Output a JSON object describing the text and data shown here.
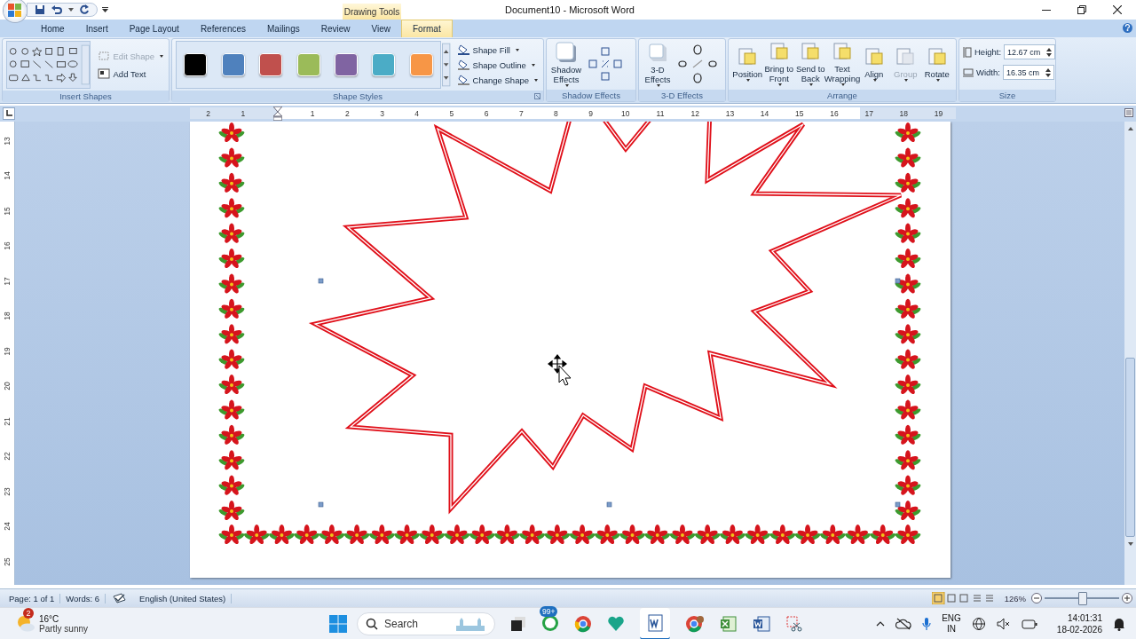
{
  "title_bar": {
    "context_label": "Drawing Tools",
    "title": "Document10 - Microsoft Word"
  },
  "tabs": [
    {
      "label": "Home",
      "selected": false
    },
    {
      "label": "Insert",
      "selected": false
    },
    {
      "label": "Page Layout",
      "selected": false
    },
    {
      "label": "References",
      "selected": false
    },
    {
      "label": "Mailings",
      "selected": false
    },
    {
      "label": "Review",
      "selected": false
    },
    {
      "label": "View",
      "selected": false
    },
    {
      "label": "Format",
      "selected": true
    }
  ],
  "ribbon": {
    "insert_shapes": {
      "edit_shape": {
        "label": "Edit Shape",
        "disabled": true
      },
      "add_text": {
        "label": "Add Text",
        "disabled": false
      },
      "group_label": "Insert Shapes"
    },
    "shape_styles": {
      "swatches": [
        {
          "color": "#000000"
        },
        {
          "color": "#4f81bd"
        },
        {
          "color": "#c0504d"
        },
        {
          "color": "#9bbb59"
        },
        {
          "color": "#8064a2"
        },
        {
          "color": "#4bacc6"
        },
        {
          "color": "#f79646"
        }
      ],
      "commands": [
        "Shape Fill",
        "Shape Outline",
        "Change Shape"
      ],
      "group_label": "Shape Styles"
    },
    "shadow_effects": {
      "button": "Shadow Effects",
      "group_label": "Shadow Effects"
    },
    "effects_3d": {
      "button": "3-D Effects",
      "group_label": "3-D Effects"
    },
    "arrange": {
      "buttons": [
        {
          "label": "Position",
          "disabled": false
        },
        {
          "label": "Bring to Front",
          "disabled": false
        },
        {
          "label": "Send to Back",
          "disabled": false
        },
        {
          "label": "Text Wrapping",
          "disabled": false
        },
        {
          "label": "Align",
          "disabled": false
        },
        {
          "label": "Group",
          "disabled": true
        },
        {
          "label": "Rotate",
          "disabled": false
        }
      ],
      "group_label": "Arrange"
    },
    "size": {
      "height_label": "Height:",
      "height": "12.67 cm",
      "width_label": "Width:",
      "width": "16.35 cm",
      "group_label": "Size"
    }
  },
  "ruler": {
    "h_labels": [
      "2",
      "1",
      "1",
      "2",
      "3",
      "4",
      "5",
      "6",
      "7",
      "8",
      "9",
      "10",
      "11",
      "12",
      "13",
      "14",
      "15",
      "16",
      "17",
      "18",
      "19"
    ],
    "v_labels": [
      "13",
      "14",
      "15",
      "16",
      "17",
      "18",
      "19",
      "20",
      "21",
      "22",
      "23",
      "24",
      "25"
    ]
  },
  "status_bar": {
    "page": "Page: 1 of 1",
    "words": "Words: 6",
    "language": "English (United States)",
    "zoom": "126%",
    "zoom_slider": {
      "level": 0.5
    }
  },
  "taskbar": {
    "weather": {
      "badge": "2",
      "temperature": "16°C",
      "condition": "Partly sunny"
    },
    "search": {
      "placeholder": "Search"
    },
    "chat_badge": "99+",
    "language": {
      "line1": "ENG",
      "line2": "IN"
    },
    "time": "14:01:31",
    "date": "18-02-2026"
  }
}
